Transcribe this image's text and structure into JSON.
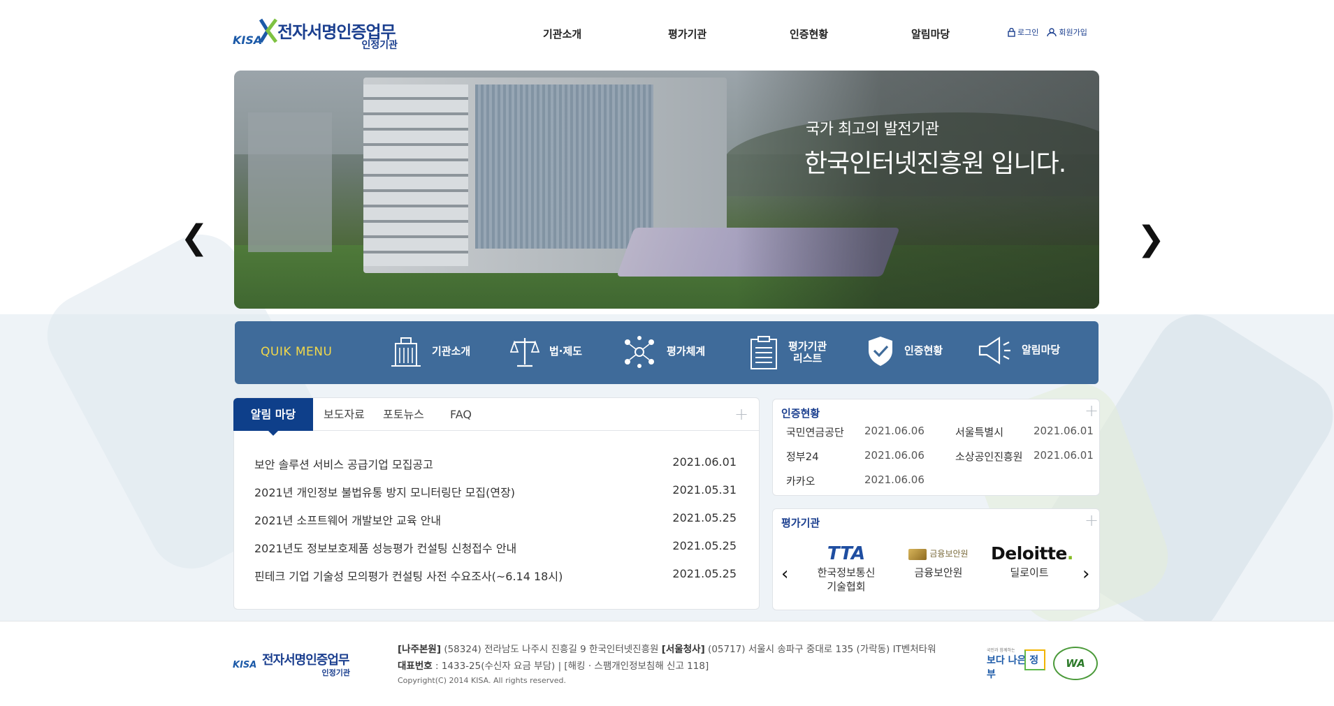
{
  "header": {
    "logo_brand": "KISA",
    "logo_title": "전자서명인증업무",
    "logo_subtitle": "인정기관",
    "nav": [
      "기관소개",
      "평가기관",
      "인증현황",
      "알림마당"
    ],
    "login_label": "로그인",
    "join_label": "회원가입"
  },
  "banner": {
    "line1": "국가 최고의 발전기관",
    "line2": "한국인터넷진흥원 입니다.",
    "prev_icon": "chevron-left-icon",
    "next_icon": "chevron-right-icon"
  },
  "quick_menu": {
    "title": "QUIK MENU",
    "items": [
      {
        "label": "기관소개",
        "icon": "building-icon"
      },
      {
        "label": "법·제도",
        "icon": "scale-icon"
      },
      {
        "label": "평가체계",
        "icon": "network-icon"
      },
      {
        "label": "평가기관\n리스트",
        "icon": "clipboard-list-icon"
      },
      {
        "label": "인증현황",
        "icon": "shield-check-icon"
      },
      {
        "label": "알림마당",
        "icon": "megaphone-icon"
      }
    ]
  },
  "board": {
    "tabs": [
      "알림 마당",
      "보도자료",
      "포토뉴스",
      "FAQ"
    ],
    "more_label": "+",
    "items": [
      {
        "title": "보안 솔루션 서비스 공급기업 모집공고",
        "date": "2021.06.01"
      },
      {
        "title": "2021년 개인정보 불법유통 방지 모니터링단 모집(연장)",
        "date": "2021.05.31"
      },
      {
        "title": "2021년 소프트웨어 개발보안 교육 안내",
        "date": "2021.05.25"
      },
      {
        "title": "2021년도 정보보호제품 성능평가 컨설팅 신청접수 안내",
        "date": "2021.05.25"
      },
      {
        "title": "핀테크 기업 기술성 모의평가 컨설팅 사전 수요조사(~6.14 18시)",
        "date": "2021.05.25"
      }
    ]
  },
  "cert": {
    "title": "인증현황",
    "more_label": "+",
    "items": [
      {
        "org": "국민연금공단",
        "date": "2021.06.06"
      },
      {
        "org": "서울특별시",
        "date": "2021.06.01"
      },
      {
        "org": "정부24",
        "date": "2021.06.06"
      },
      {
        "org": "소상공인진흥원",
        "date": "2021.06.01"
      },
      {
        "org": "카카오",
        "date": "2021.06.06"
      }
    ]
  },
  "evaluators": {
    "title": "평가기관",
    "more_label": "+",
    "items": [
      {
        "logo_text": "TTA",
        "name": "한국정보통신\n기술협회"
      },
      {
        "logo_text": "금융보안원",
        "name": "금융보안원"
      },
      {
        "logo_text": "Deloitte",
        "name": "딜로이트"
      }
    ]
  },
  "footer": {
    "logo_brand": "KISA",
    "logo_title": "전자서명인증업무",
    "logo_subtitle": "인정기관",
    "hq_label": "[나주본원]",
    "hq_address": "(58324) 전라남도 나주시 진흥길 9 한국인터넷진흥원",
    "seoul_label": "[서울청사]",
    "seoul_address": "(05717) 서울시 송파구 중대로 135 (가락동) IT벤처타워",
    "phone_label": "대표번호",
    "phone_text": ": 1433-25(수신자 요금 부담) | [해킹 · 스팸개인정보침해 신고 118]",
    "copyright": "Copyright(C) 2014 KISA. All rights reserved.",
    "badge1_small": "국민과 함께하는",
    "badge1_big": "보다 나은 정부",
    "badge2": "WA"
  },
  "colors": {
    "brand_navy": "#1b3f8f",
    "quick_menu_bg": "#3f6b9a",
    "quick_menu_title": "#f2d84a",
    "active_tab": "#0e3f8a"
  }
}
